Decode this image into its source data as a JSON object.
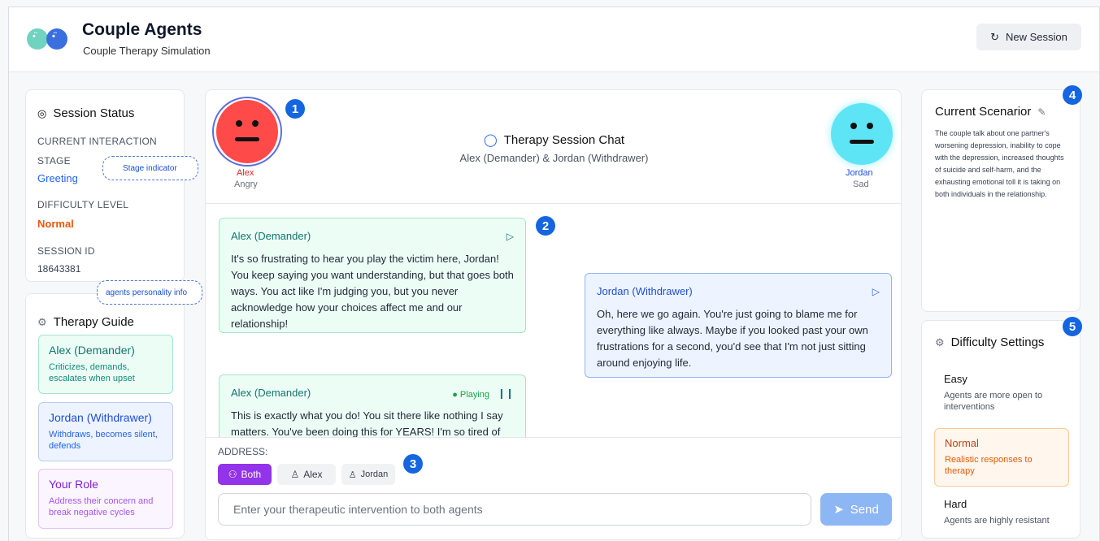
{
  "header": {
    "title": "Couple Agents",
    "subtitle": "Couple Therapy Simulation",
    "new_session_label": "New Session"
  },
  "session_status": {
    "title": "Session Status",
    "interaction_label": "CURRENT INTERACTION",
    "stage_label": "STAGE",
    "stage_value": "Greeting",
    "stage_callout": "Stage indicator",
    "difficulty_label": "DIFFICULTY LEVEL",
    "difficulty_value": "Normal",
    "session_id_label": "SESSION ID",
    "session_id_value": "18643381"
  },
  "therapy_guide": {
    "callout": "agents personality info",
    "title": "Therapy Guide",
    "cards": [
      {
        "title": "Alex (Demander)",
        "desc": "Criticizes, demands, escalates when upset"
      },
      {
        "title": "Jordan (Withdrawer)",
        "desc": "Withdraws, becomes silent, defends"
      },
      {
        "title": "Your Role",
        "desc": "Address their concern and break negative cycles"
      }
    ]
  },
  "chat": {
    "title": "Therapy Session Chat",
    "subtitle": "Alex (Demander) & Jordan (Withdrawer)",
    "left_agent": {
      "name": "Alex",
      "emotion": "Angry"
    },
    "right_agent": {
      "name": "Jordan",
      "emotion": "Sad"
    },
    "messages": [
      {
        "speaker": "Alex (Demander)",
        "text": "It's so frustrating to hear you play the victim here, Jordan! You keep saying  you want understanding, but that goes both ways. You act like I'm judging you, but you never acknowledge how your choices affect me and our relationship!"
      },
      {
        "speaker": "Jordan (Withdrawer)",
        "text": "Oh, here we go again. You're just going to blame me for everything like always. Maybe if you looked past your own frustrations for a second, you'd see that I'm not just sitting around enjoying life."
      },
      {
        "speaker": "Alex (Demander)",
        "status": "Playing",
        "text": "This is exactly what you do! You sit there like nothing I say matters. You've been doing this for YEARS! I'm so tired of"
      }
    ],
    "address_label": "ADDRESS:",
    "address_options": [
      "Both",
      "Alex",
      "Jordan"
    ],
    "input_placeholder": "Enter your therapeutic intervention to both agents",
    "send_label": "Send"
  },
  "scenario": {
    "title": "Current Scenarior",
    "text": "The couple talk about one partner's worsening depression, inability to cope with the depression, increased thoughts of suicide and self-harm, and the exhausting emotional toll it is taking on both individuals in the relationship."
  },
  "difficulty_settings": {
    "title": "Difficulty Settings",
    "options": [
      {
        "title": "Easy",
        "desc": "Agents are more open to interventions"
      },
      {
        "title": "Normal",
        "desc": "Realistic responses to therapy"
      },
      {
        "title": "Hard",
        "desc": "Agents are highly resistant"
      }
    ]
  },
  "markers": [
    "1",
    "2",
    "3",
    "4",
    "5"
  ],
  "colors": {
    "accent": "#1565e0",
    "alex": "#ff4a4a",
    "jordan": "#5ee5f5",
    "role": "#9333ea",
    "normal": "#ea580c"
  }
}
